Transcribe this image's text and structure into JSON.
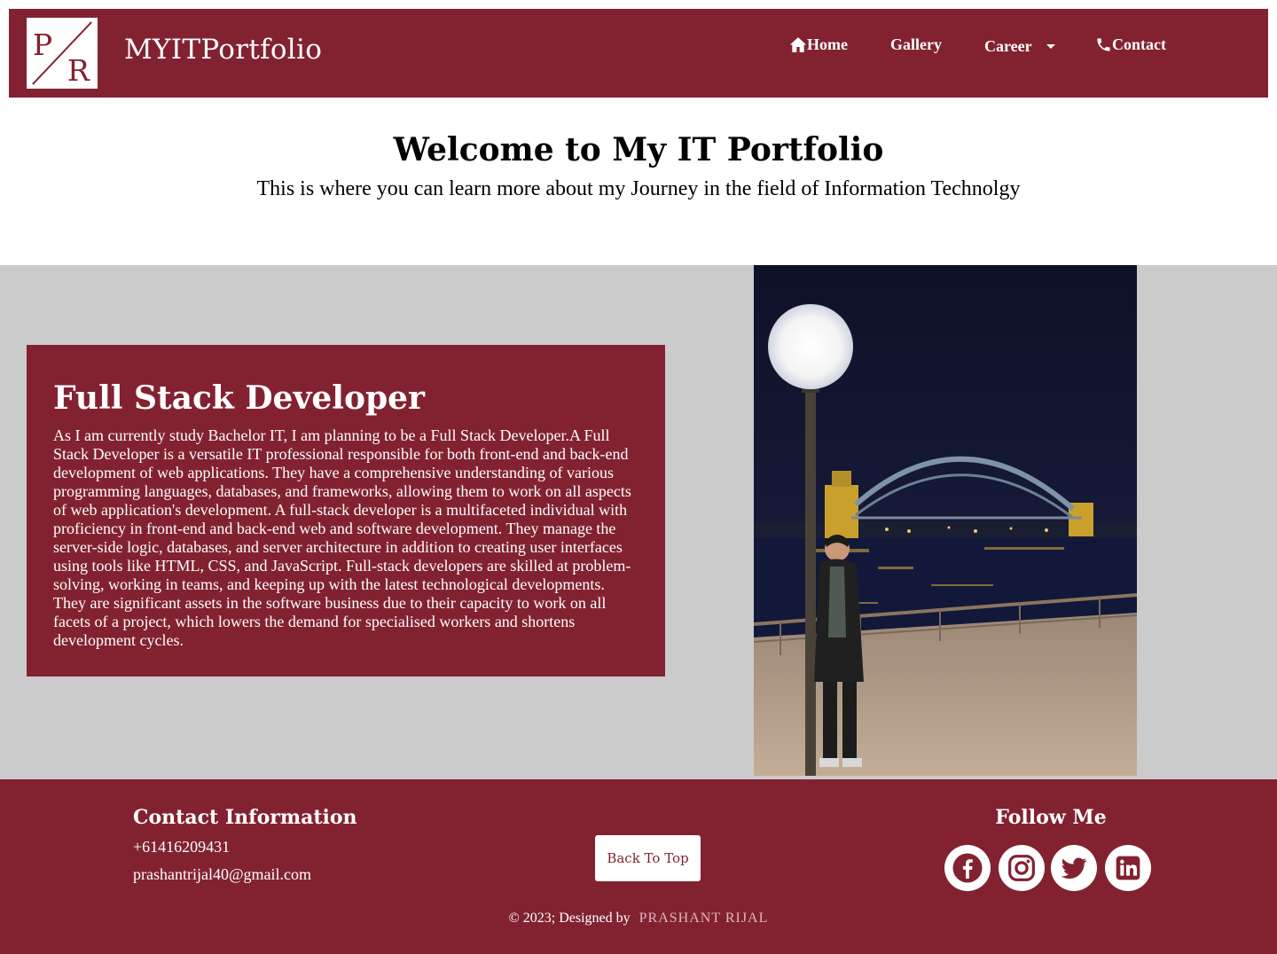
{
  "brand": {
    "logo_letters": "P/R",
    "name": "MYITPortfolio"
  },
  "nav": {
    "home": "Home",
    "gallery": "Gallery",
    "career": "Career",
    "contact": "Contact"
  },
  "hero": {
    "title": "Welcome to My IT Portfolio",
    "subtitle": "This is where you can learn more about my Journey in the field of Information Technolgy"
  },
  "role": {
    "title": "Full Stack Developer",
    "description": "As I am currently study Bachelor IT, I am planning to be a Full Stack Developer.A Full Stack Developer is a versatile IT professional responsible for both front-end and back-end development of web applications. They have a comprehensive understanding of various programming languages, databases, and frameworks, allowing them to work on all aspects of web application's development. A full-stack developer is a multifaceted individual with proficiency in front-end and back-end web and software development. They manage the server-side logic, databases, and server architecture in addition to creating user interfaces using tools like HTML, CSS, and JavaScript. Full-stack developers are skilled at problem-solving, working in teams, and keeping up with the latest technological developments. They are significant assets in the software business due to their capacity to work on all facets of a project, which lowers the demand for specialised workers and shortens development cycles."
  },
  "footer": {
    "contact_title": "Contact Information",
    "phone": "+61416209431",
    "email": "prashantrijal40@gmail.com",
    "back_to_top": "Back To Top",
    "follow_title": "Follow Me",
    "socials": [
      "facebook-icon",
      "instagram-icon",
      "twitter-icon",
      "linkedin-icon"
    ],
    "copyright": "© 2023; Designed by",
    "designer": "PRASHANT RIJAL"
  },
  "colors": {
    "brand": "#822231",
    "section_bg": "#cbcbcb",
    "white": "#ffffff"
  }
}
